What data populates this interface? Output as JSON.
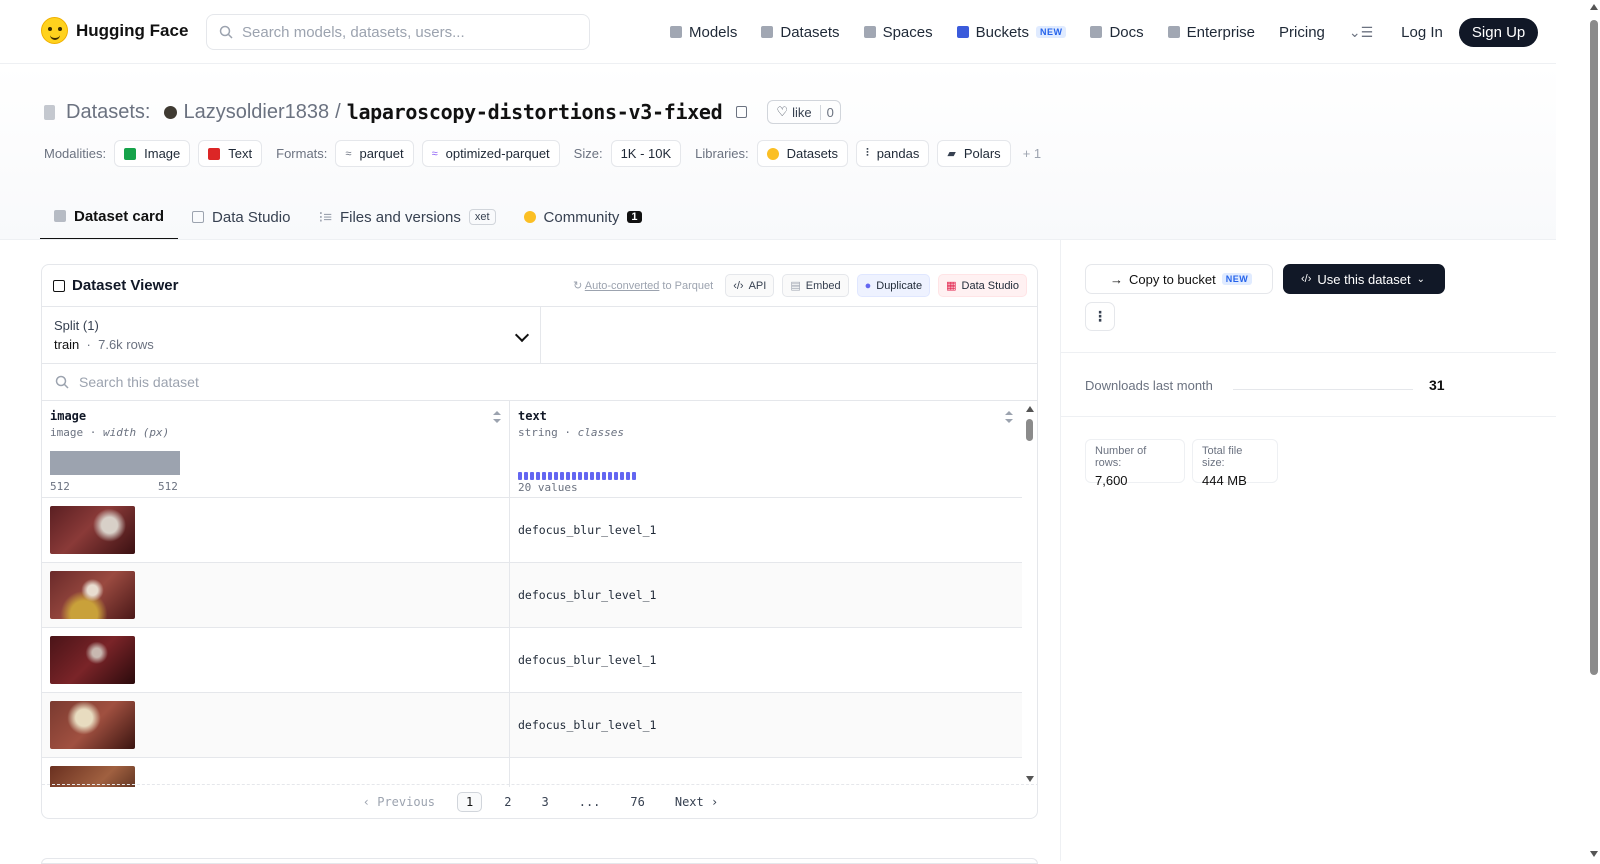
{
  "nav": {
    "brand": "Hugging Face",
    "search_placeholder": "Search models, datasets, users...",
    "links": [
      {
        "label": "Models",
        "icon": "cube-icon"
      },
      {
        "label": "Datasets",
        "icon": "database-icon"
      },
      {
        "label": "Spaces",
        "icon": "grid-icon"
      },
      {
        "label": "Buckets",
        "icon": "bucket-icon",
        "badge": "NEW"
      },
      {
        "label": "Docs",
        "icon": "book-icon"
      },
      {
        "label": "Enterprise",
        "icon": "building-icon"
      },
      {
        "label": "Pricing"
      }
    ],
    "login": "Log In",
    "signup": "Sign Up"
  },
  "header": {
    "section": "Datasets:",
    "owner": "Lazysoldier1838",
    "separator": "/",
    "repo": "laparoscopy-distortions-v3-fixed",
    "like_label": "like",
    "like_count": "0",
    "modalities_label": "Modalities:",
    "modalities": [
      "Image",
      "Text"
    ],
    "formats_label": "Formats:",
    "formats": [
      "parquet",
      "optimized-parquet"
    ],
    "size_label": "Size:",
    "size": "1K - 10K",
    "libraries_label": "Libraries:",
    "libraries": [
      "Datasets",
      "pandas",
      "Polars"
    ],
    "more": "+ 1"
  },
  "tabs": [
    {
      "label": "Dataset card",
      "active": true
    },
    {
      "label": "Data Studio"
    },
    {
      "label": "Files and versions",
      "badge": "xet"
    },
    {
      "label": "Community",
      "badge": "1"
    }
  ],
  "viewer": {
    "title": "Dataset Viewer",
    "auto_converted": "Auto-converted",
    "to_parquet": " to Parquet",
    "api": "API",
    "embed": "Embed",
    "duplicate": "Duplicate",
    "data_studio": "Data Studio",
    "split_label": "Split (1)",
    "split_name": "train",
    "split_sep": "·",
    "split_rows": "7.6k rows",
    "search_placeholder": "Search this dataset",
    "columns": [
      {
        "name": "image",
        "type": "image",
        "sub": "width (px)",
        "min": "512",
        "max": "512"
      },
      {
        "name": "text",
        "type": "string",
        "sub": "classes",
        "values": "20 values"
      }
    ],
    "rows": [
      {
        "text": "defocus_blur_level_1"
      },
      {
        "text": "defocus_blur_level_1"
      },
      {
        "text": "defocus_blur_level_1"
      },
      {
        "text": "defocus_blur_level_1"
      },
      {
        "text": ""
      }
    ],
    "pager": {
      "prev": "Previous",
      "pages": [
        "1",
        "2",
        "3",
        "...",
        "76"
      ],
      "next": "Next",
      "current": "1"
    }
  },
  "sidebar": {
    "copy_bucket": "Copy to bucket",
    "copy_badge": "NEW",
    "use_dataset": "Use this dataset",
    "more": "⋮",
    "downloads_label": "Downloads last month",
    "downloads_value": "31",
    "rows_label": "Number of rows:",
    "rows_value": "7,600",
    "filesize_label": "Total file size:",
    "filesize_value": "444 MB"
  }
}
